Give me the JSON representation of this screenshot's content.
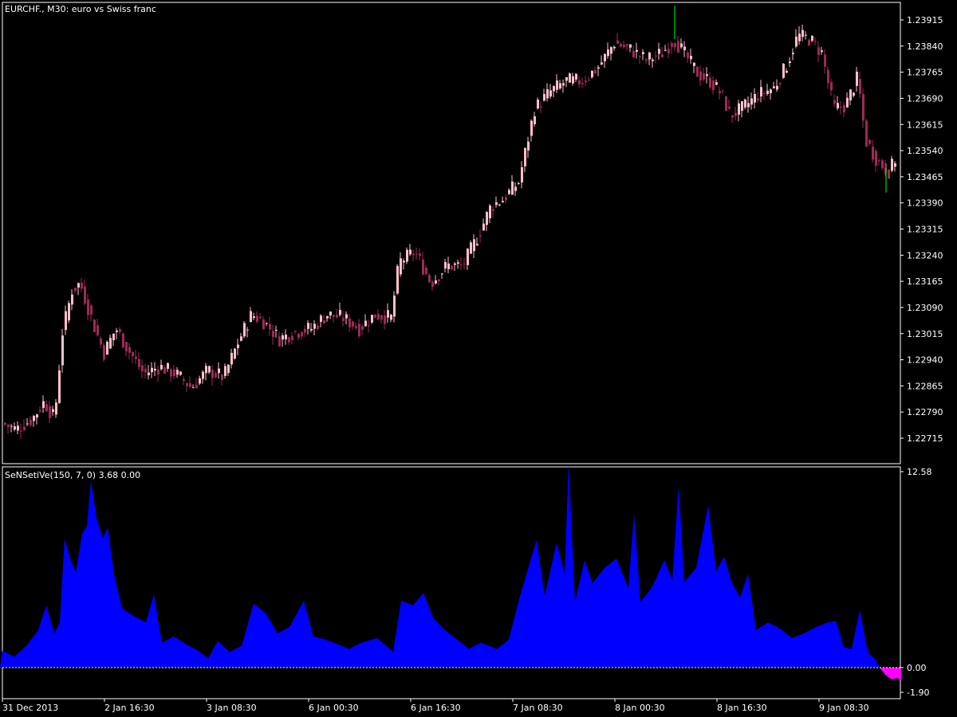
{
  "colors": {
    "background": "#000000",
    "frame": "#ffffff",
    "bull_candle": "#ffc0cb",
    "bear_candle": "#9c2b55",
    "wick_highlight": "#00ff00",
    "indicator_positive": "#0000ff",
    "indicator_negative": "#ff00ff",
    "zero_line": "#ffffff"
  },
  "main_panel": {
    "title": "EURCHF., M30:  euro vs Swiss franc"
  },
  "indicator_panel": {
    "title": "SeNSetiVe(150, 7, 0) 3.68 0.00"
  },
  "chart_data": [
    {
      "type": "candlestick",
      "symbol": "EURCHF.",
      "timeframe": "M30",
      "y_ticks": [
        "1.23915",
        "1.23840",
        "1.23765",
        "1.23690",
        "1.23615",
        "1.23540",
        "1.23465",
        "1.23390",
        "1.23315",
        "1.23240",
        "1.23165",
        "1.23090",
        "1.23015",
        "1.22940",
        "1.22865",
        "1.22790",
        "1.22715"
      ],
      "ylim": [
        1.2268,
        1.2397
      ],
      "x_ticks": [
        "31 Dec 2013",
        "2 Jan 16:30",
        "3 Jan 08:30",
        "6 Jan 00:30",
        "6 Jan 16:30",
        "7 Jan 08:30",
        "8 Jan 00:30",
        "8 Jan 16:30",
        "9 Jan 08:30"
      ],
      "close_path": [
        [
          0,
          1.2276
        ],
        [
          20,
          1.2274
        ],
        [
          40,
          1.2277
        ],
        [
          55,
          1.2282
        ],
        [
          68,
          1.2277
        ],
        [
          78,
          1.2302
        ],
        [
          90,
          1.2314
        ],
        [
          100,
          1.2316
        ],
        [
          110,
          1.2309
        ],
        [
          120,
          1.2302
        ],
        [
          130,
          1.2296
        ],
        [
          145,
          1.2303
        ],
        [
          160,
          1.2297
        ],
        [
          180,
          1.229
        ],
        [
          200,
          1.2292
        ],
        [
          220,
          1.229
        ],
        [
          240,
          1.2286
        ],
        [
          260,
          1.2291
        ],
        [
          280,
          1.2289
        ],
        [
          300,
          1.23
        ],
        [
          315,
          1.2307
        ],
        [
          330,
          1.2305
        ],
        [
          350,
          1.23
        ],
        [
          370,
          1.2302
        ],
        [
          390,
          1.2303
        ],
        [
          410,
          1.2307
        ],
        [
          430,
          1.2306
        ],
        [
          450,
          1.2303
        ],
        [
          470,
          1.2307
        ],
        [
          490,
          1.2306
        ],
        [
          500,
          1.2322
        ],
        [
          520,
          1.2325
        ],
        [
          540,
          1.2316
        ],
        [
          560,
          1.2321
        ],
        [
          580,
          1.2321
        ],
        [
          600,
          1.233
        ],
        [
          615,
          1.2338
        ],
        [
          630,
          1.234
        ],
        [
          650,
          1.2345
        ],
        [
          670,
          1.2366
        ],
        [
          690,
          1.2371
        ],
        [
          710,
          1.2374
        ],
        [
          730,
          1.2374
        ],
        [
          750,
          1.2378
        ],
        [
          770,
          1.2385
        ],
        [
          790,
          1.2383
        ],
        [
          810,
          1.238
        ],
        [
          830,
          1.2382
        ],
        [
          845,
          1.2386
        ],
        [
          860,
          1.2381
        ],
        [
          875,
          1.2376
        ],
        [
          890,
          1.2374
        ],
        [
          905,
          1.237
        ],
        [
          915,
          1.2364
        ],
        [
          930,
          1.2366
        ],
        [
          950,
          1.237
        ],
        [
          970,
          1.2372
        ],
        [
          985,
          1.2378
        ],
        [
          1000,
          1.2387
        ],
        [
          1015,
          1.2386
        ],
        [
          1030,
          1.2382
        ],
        [
          1045,
          1.2366
        ],
        [
          1060,
          1.2367
        ],
        [
          1075,
          1.2375
        ],
        [
          1085,
          1.2357
        ],
        [
          1100,
          1.2351
        ],
        [
          1115,
          1.2348
        ],
        [
          1125,
          1.2353
        ]
      ],
      "max_high": 1.23955
    },
    {
      "type": "area",
      "name": "SeNSetiVe(150, 7, 0)",
      "y_ticks": [
        "12.58",
        "0.00",
        "-1.90"
      ],
      "ylim": [
        -1.9,
        12.58
      ],
      "series": [
        [
          0,
          1.1
        ],
        [
          15,
          0.7
        ],
        [
          30,
          1.4
        ],
        [
          45,
          2.4
        ],
        [
          55,
          4.0
        ],
        [
          65,
          2.2
        ],
        [
          72,
          2.9
        ],
        [
          78,
          8.3
        ],
        [
          85,
          7.0
        ],
        [
          92,
          6.1
        ],
        [
          100,
          8.6
        ],
        [
          106,
          9.1
        ],
        [
          111,
          12.0
        ],
        [
          118,
          9.6
        ],
        [
          126,
          8.3
        ],
        [
          132,
          9.0
        ],
        [
          140,
          6.0
        ],
        [
          150,
          3.8
        ],
        [
          165,
          3.3
        ],
        [
          180,
          2.9
        ],
        [
          190,
          4.7
        ],
        [
          200,
          1.6
        ],
        [
          215,
          2.0
        ],
        [
          230,
          1.5
        ],
        [
          245,
          1.1
        ],
        [
          258,
          0.6
        ],
        [
          270,
          1.7
        ],
        [
          285,
          1.0
        ],
        [
          300,
          1.4
        ],
        [
          315,
          4.1
        ],
        [
          330,
          3.5
        ],
        [
          345,
          2.2
        ],
        [
          360,
          2.6
        ],
        [
          378,
          4.3
        ],
        [
          390,
          2.0
        ],
        [
          405,
          1.8
        ],
        [
          420,
          1.5
        ],
        [
          435,
          1.2
        ],
        [
          450,
          1.6
        ],
        [
          470,
          1.9
        ],
        [
          490,
          1.0
        ],
        [
          500,
          4.3
        ],
        [
          515,
          4.0
        ],
        [
          528,
          4.8
        ],
        [
          540,
          3.2
        ],
        [
          555,
          2.4
        ],
        [
          570,
          1.8
        ],
        [
          585,
          1.2
        ],
        [
          600,
          1.6
        ],
        [
          620,
          1.2
        ],
        [
          635,
          1.8
        ],
        [
          648,
          4.4
        ],
        [
          660,
          6.5
        ],
        [
          670,
          8.2
        ],
        [
          680,
          4.6
        ],
        [
          695,
          8.0
        ],
        [
          705,
          6.0
        ],
        [
          710,
          13.1
        ],
        [
          718,
          4.2
        ],
        [
          730,
          6.9
        ],
        [
          740,
          5.4
        ],
        [
          755,
          6.4
        ],
        [
          770,
          7.0
        ],
        [
          785,
          5.1
        ],
        [
          792,
          9.9
        ],
        [
          800,
          4.2
        ],
        [
          815,
          5.2
        ],
        [
          830,
          6.9
        ],
        [
          840,
          5.6
        ],
        [
          848,
          11.7
        ],
        [
          855,
          5.5
        ],
        [
          870,
          6.4
        ],
        [
          885,
          10.4
        ],
        [
          895,
          6.2
        ],
        [
          905,
          7.1
        ],
        [
          915,
          5.4
        ],
        [
          925,
          4.5
        ],
        [
          935,
          6.0
        ],
        [
          945,
          2.4
        ],
        [
          960,
          2.9
        ],
        [
          975,
          2.5
        ],
        [
          990,
          1.9
        ],
        [
          1005,
          2.2
        ],
        [
          1020,
          2.6
        ],
        [
          1035,
          2.9
        ],
        [
          1045,
          3.0
        ],
        [
          1055,
          1.3
        ],
        [
          1065,
          1.2
        ],
        [
          1075,
          3.7
        ],
        [
          1085,
          1.0
        ],
        [
          1095,
          0.5
        ],
        [
          1100,
          0.0
        ],
        [
          1108,
          -0.6
        ],
        [
          1115,
          -0.9
        ],
        [
          1122,
          -0.8
        ],
        [
          1127,
          -1.0
        ]
      ]
    }
  ]
}
